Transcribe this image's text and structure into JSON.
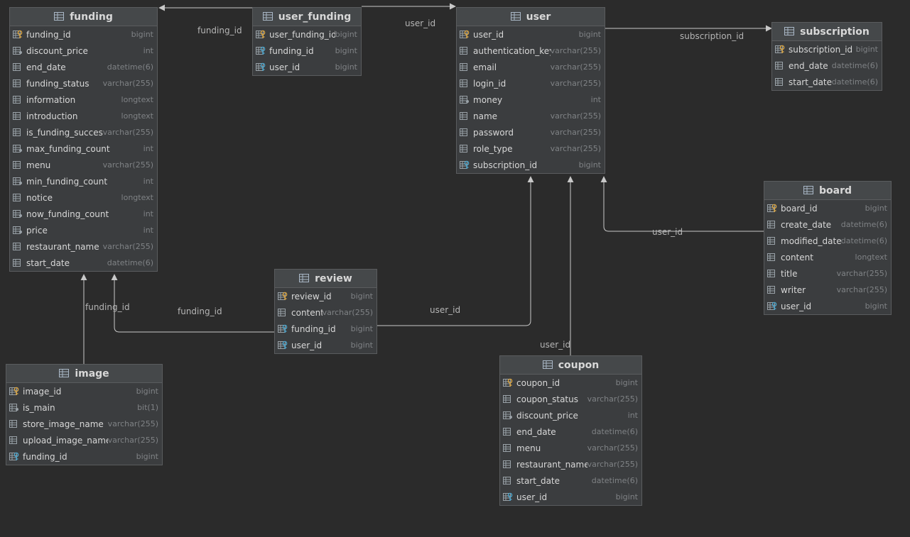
{
  "tables": {
    "funding": {
      "name": "funding",
      "columns": [
        {
          "name": "funding_id",
          "type": "bigint",
          "kind": "pk"
        },
        {
          "name": "discount_price",
          "type": "int",
          "kind": "nn"
        },
        {
          "name": "end_date",
          "type": "datetime(6)",
          "kind": "col"
        },
        {
          "name": "funding_status",
          "type": "varchar(255)",
          "kind": "col"
        },
        {
          "name": "information",
          "type": "longtext",
          "kind": "col"
        },
        {
          "name": "introduction",
          "type": "longtext",
          "kind": "col"
        },
        {
          "name": "is_funding_success",
          "type": "varchar(255)",
          "kind": "col"
        },
        {
          "name": "max_funding_count",
          "type": "int",
          "kind": "nn"
        },
        {
          "name": "menu",
          "type": "varchar(255)",
          "kind": "col"
        },
        {
          "name": "min_funding_count",
          "type": "int",
          "kind": "nn"
        },
        {
          "name": "notice",
          "type": "longtext",
          "kind": "col"
        },
        {
          "name": "now_funding_count",
          "type": "int",
          "kind": "nn"
        },
        {
          "name": "price",
          "type": "int",
          "kind": "nn"
        },
        {
          "name": "restaurant_name",
          "type": "varchar(255)",
          "kind": "col"
        },
        {
          "name": "start_date",
          "type": "datetime(6)",
          "kind": "col"
        }
      ]
    },
    "user_funding": {
      "name": "user_funding",
      "columns": [
        {
          "name": "user_funding_id",
          "type": "bigint",
          "kind": "pk"
        },
        {
          "name": "funding_id",
          "type": "bigint",
          "kind": "fk"
        },
        {
          "name": "user_id",
          "type": "bigint",
          "kind": "fk"
        }
      ]
    },
    "user": {
      "name": "user",
      "columns": [
        {
          "name": "user_id",
          "type": "bigint",
          "kind": "pk"
        },
        {
          "name": "authentication_key",
          "type": "varchar(255)",
          "kind": "col"
        },
        {
          "name": "email",
          "type": "varchar(255)",
          "kind": "col"
        },
        {
          "name": "login_id",
          "type": "varchar(255)",
          "kind": "col"
        },
        {
          "name": "money",
          "type": "int",
          "kind": "nn"
        },
        {
          "name": "name",
          "type": "varchar(255)",
          "kind": "col"
        },
        {
          "name": "password",
          "type": "varchar(255)",
          "kind": "col"
        },
        {
          "name": "role_type",
          "type": "varchar(255)",
          "kind": "col"
        },
        {
          "name": "subscription_id",
          "type": "bigint",
          "kind": "fk"
        }
      ]
    },
    "subscription": {
      "name": "subscription",
      "columns": [
        {
          "name": "subscription_id",
          "type": "bigint",
          "kind": "pk"
        },
        {
          "name": "end_date",
          "type": "datetime(6)",
          "kind": "col"
        },
        {
          "name": "start_date",
          "type": "datetime(6)",
          "kind": "col"
        }
      ]
    },
    "board": {
      "name": "board",
      "columns": [
        {
          "name": "board_id",
          "type": "bigint",
          "kind": "pk"
        },
        {
          "name": "create_date",
          "type": "datetime(6)",
          "kind": "col"
        },
        {
          "name": "modified_date",
          "type": "datetime(6)",
          "kind": "col"
        },
        {
          "name": "content",
          "type": "longtext",
          "kind": "col"
        },
        {
          "name": "title",
          "type": "varchar(255)",
          "kind": "col"
        },
        {
          "name": "writer",
          "type": "varchar(255)",
          "kind": "col"
        },
        {
          "name": "user_id",
          "type": "bigint",
          "kind": "fk"
        }
      ]
    },
    "review": {
      "name": "review",
      "columns": [
        {
          "name": "review_id",
          "type": "bigint",
          "kind": "pk"
        },
        {
          "name": "content",
          "type": "varchar(255)",
          "kind": "col"
        },
        {
          "name": "funding_id",
          "type": "bigint",
          "kind": "fk"
        },
        {
          "name": "user_id",
          "type": "bigint",
          "kind": "fk"
        }
      ]
    },
    "image": {
      "name": "image",
      "columns": [
        {
          "name": "image_id",
          "type": "bigint",
          "kind": "pk"
        },
        {
          "name": "is_main",
          "type": "bit(1)",
          "kind": "nn"
        },
        {
          "name": "store_image_name",
          "type": "varchar(255)",
          "kind": "col"
        },
        {
          "name": "upload_image_name",
          "type": "varchar(255)",
          "kind": "col"
        },
        {
          "name": "funding_id",
          "type": "bigint",
          "kind": "fk"
        }
      ]
    },
    "coupon": {
      "name": "coupon",
      "columns": [
        {
          "name": "coupon_id",
          "type": "bigint",
          "kind": "pk"
        },
        {
          "name": "coupon_status",
          "type": "varchar(255)",
          "kind": "col"
        },
        {
          "name": "discount_price",
          "type": "int",
          "kind": "nn"
        },
        {
          "name": "end_date",
          "type": "datetime(6)",
          "kind": "col"
        },
        {
          "name": "menu",
          "type": "varchar(255)",
          "kind": "col"
        },
        {
          "name": "restaurant_name",
          "type": "varchar(255)",
          "kind": "col"
        },
        {
          "name": "start_date",
          "type": "datetime(6)",
          "kind": "col"
        },
        {
          "name": "user_id",
          "type": "bigint",
          "kind": "fk"
        }
      ]
    }
  },
  "relations": [
    {
      "from": "user_funding",
      "to": "funding",
      "label": "funding_id"
    },
    {
      "from": "user_funding",
      "to": "user",
      "label": "user_id"
    },
    {
      "from": "user",
      "to": "subscription",
      "label": "subscription_id"
    },
    {
      "from": "board",
      "to": "user",
      "label": "user_id"
    },
    {
      "from": "review",
      "to": "funding",
      "label": "funding_id"
    },
    {
      "from": "review",
      "to": "user",
      "label": "user_id"
    },
    {
      "from": "image",
      "to": "funding",
      "label": "funding_id"
    },
    {
      "from": "coupon",
      "to": "user",
      "label": "user_id"
    }
  ],
  "colors": {
    "background": "#2b2b2b",
    "line": "#c8c8c8",
    "key_gold": "#d9a441",
    "key_blue": "#4aa3c9"
  }
}
